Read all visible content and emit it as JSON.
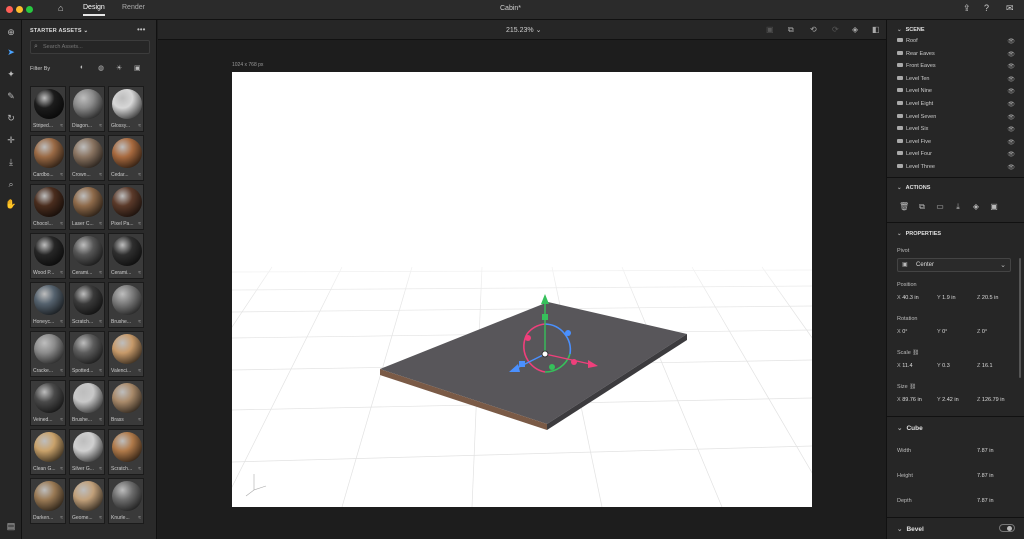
{
  "window": {
    "title": "Cabin*"
  },
  "tabs": [
    {
      "label": "Design"
    },
    {
      "label": "Render"
    }
  ],
  "left_panel": {
    "title": "STARTER ASSETS",
    "search_placeholder": "Search Assets...",
    "filter_label": "Filter By",
    "materials": [
      {
        "label": "Striped...",
        "color": "#1c1c1c"
      },
      {
        "label": "Diagon...",
        "color": "#8a8a8a"
      },
      {
        "label": "Glossy...",
        "color": "#d7d7d7"
      },
      {
        "label": "Cardbo...",
        "color": "#9a6a45"
      },
      {
        "label": "Crown...",
        "color": "#8a7461"
      },
      {
        "label": "Cedar...",
        "color": "#a86a3f"
      },
      {
        "label": "Chocol...",
        "color": "#4a2d1e"
      },
      {
        "label": "Laser C...",
        "color": "#8e6a4a"
      },
      {
        "label": "Pixel Pa...",
        "color": "#5b3a2a"
      },
      {
        "label": "Wood P...",
        "color": "#262626"
      },
      {
        "label": "Cerami...",
        "color": "#565656"
      },
      {
        "label": "Cerami...",
        "color": "#2f2f2f"
      },
      {
        "label": "Honeyc...",
        "color": "#55626e"
      },
      {
        "label": "Scratch...",
        "color": "#3a3a3a"
      },
      {
        "label": "Brushe...",
        "color": "#7c7c7c"
      },
      {
        "label": "Cracke...",
        "color": "#8c8c8c"
      },
      {
        "label": "Spotted...",
        "color": "#5c5c5c"
      },
      {
        "label": "Valenci...",
        "color": "#c79a6a"
      },
      {
        "label": "Veined...",
        "color": "#4a4a4a"
      },
      {
        "label": "Brushe...",
        "color": "#c8c8c8"
      },
      {
        "label": "Brass",
        "color": "#a98a6a"
      },
      {
        "label": "Clean G...",
        "color": "#c9a26b"
      },
      {
        "label": "Silver G...",
        "color": "#d0d0d0"
      },
      {
        "label": "Scratch...",
        "color": "#b07a4a"
      },
      {
        "label": "Darken...",
        "color": "#9a7a55"
      },
      {
        "label": "Geome...",
        "color": "#c1a07a"
      },
      {
        "label": "Knurle...",
        "color": "#6c6c6c"
      }
    ]
  },
  "viewport": {
    "zoom": "215.23%",
    "size_label": "1024 x 768 px"
  },
  "scene": {
    "title": "SCENE",
    "layers": [
      "Roof",
      "Rear Eaves",
      "Front Eaves",
      "Level Ten",
      "Level Nine",
      "Level Eight",
      "Level Seven",
      "Level Six",
      "Level Five",
      "Level Four",
      "Level Three"
    ]
  },
  "actions": {
    "title": "ACTIONS"
  },
  "properties": {
    "title": "PROPERTIES",
    "pivot_label": "Pivot",
    "pivot_value": "Center",
    "position": {
      "label": "Position",
      "x": "40.3 in",
      "y": "1.9 in",
      "z": "20.5 in"
    },
    "rotation": {
      "label": "Rotation",
      "x": "0°",
      "y": "0°",
      "z": "0°"
    },
    "scale": {
      "label": "Scale",
      "x": "11.4",
      "y": "0.3",
      "z": "16.1"
    },
    "size": {
      "label": "Size",
      "x": "89.76 in",
      "y": "2.42 in",
      "z": "126.79 in"
    }
  },
  "cube": {
    "title": "Cube",
    "width": {
      "label": "Width",
      "value": "7.87 in"
    },
    "height": {
      "label": "Height",
      "value": "7.87 in"
    },
    "depth": {
      "label": "Depth",
      "value": "7.87 in"
    }
  },
  "bevel": {
    "title": "Bevel"
  }
}
